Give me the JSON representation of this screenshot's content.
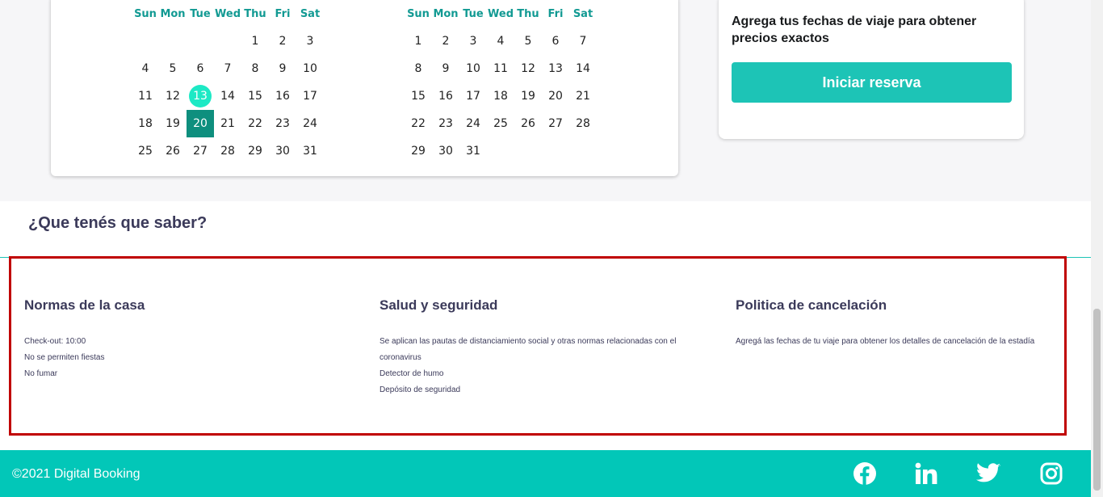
{
  "calendar": {
    "weekdays": [
      "Sun",
      "Mon",
      "Tue",
      "Wed",
      "Thu",
      "Fri",
      "Sat"
    ],
    "left_month": {
      "first_weekday": 4,
      "days": 31,
      "highlight_today": 13,
      "highlight_selected": 20
    },
    "right_month": {
      "first_weekday": 0,
      "days": 31
    }
  },
  "booking": {
    "prompt": "Agrega tus fechas de viaje para obtener precios exactos",
    "button_label": "Iniciar reserva"
  },
  "info": {
    "title": "¿Que tenés que saber?",
    "columns": [
      {
        "heading": "Normas de la casa",
        "lines": [
          "Check-out: 10:00",
          "No se permiten fiestas",
          "No fumar"
        ]
      },
      {
        "heading": "Salud y seguridad",
        "lines": [
          "Se aplican las pautas de distanciamiento social y otras normas relacionadas con el coronavirus",
          "Detector de humo",
          "Depósito de seguridad"
        ]
      },
      {
        "heading": "Politica de cancelación",
        "lines": [
          "Agregá las fechas de tu viaje para obtener los detalles de cancelación de la estadía"
        ]
      }
    ]
  },
  "footer": {
    "copyright": "©2021 Digital Booking",
    "socials": [
      "facebook-icon",
      "linkedin-icon",
      "twitter-icon",
      "instagram-icon"
    ]
  },
  "colors": {
    "accent": "#1dc4b6",
    "today": "#1de9c5",
    "selected": "#0e8f7e",
    "highlight_border": "#c00000"
  }
}
